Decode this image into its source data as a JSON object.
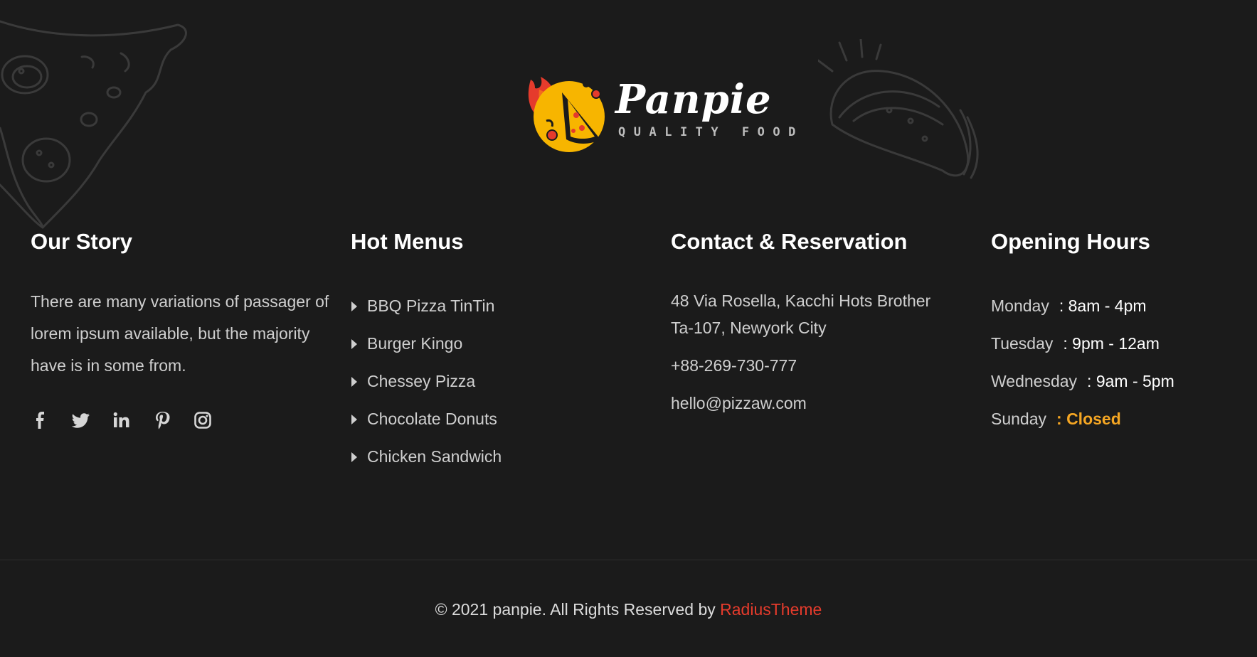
{
  "brand": {
    "name": "Panpie",
    "tagline": "QUALITY FOOD"
  },
  "story": {
    "title": "Our Story",
    "text": "There are many variations of passager of lorem ipsum available, but the majority have is in some from.",
    "social": [
      {
        "icon": "facebook-icon"
      },
      {
        "icon": "twitter-icon"
      },
      {
        "icon": "linkedin-icon"
      },
      {
        "icon": "pinterest-icon"
      },
      {
        "icon": "instagram-icon"
      }
    ]
  },
  "menus": {
    "title": "Hot Menus",
    "items": [
      "BBQ Pizza TinTin",
      "Burger Kingo",
      "Chessey Pizza",
      "Chocolate Donuts",
      "Chicken Sandwich"
    ]
  },
  "contact": {
    "title": "Contact & Reservation",
    "address": "48 Via Rosella, Kacchi Hots Brother Ta-107, Newyork City",
    "phone": "+88-269-730-777",
    "email": "hello@pizzaw.com"
  },
  "hours": {
    "title": "Opening Hours",
    "rows": [
      {
        "day": "Monday",
        "time": ": 8am - 4pm"
      },
      {
        "day": "Tuesday",
        "time": ": 9pm - 12am"
      },
      {
        "day": "Wednesday",
        "time": ": 9am - 5pm"
      },
      {
        "day": "Sunday",
        "time": ": Closed"
      }
    ]
  },
  "copyright": {
    "text": "© 2021 panpie. All Rights Reserved by ",
    "link": "RadiusTheme"
  },
  "colors": {
    "background": "#1b1b1b",
    "accent_red": "#e53b2c",
    "accent_orange": "#f5a623",
    "logo_yellow": "#f7b500"
  }
}
